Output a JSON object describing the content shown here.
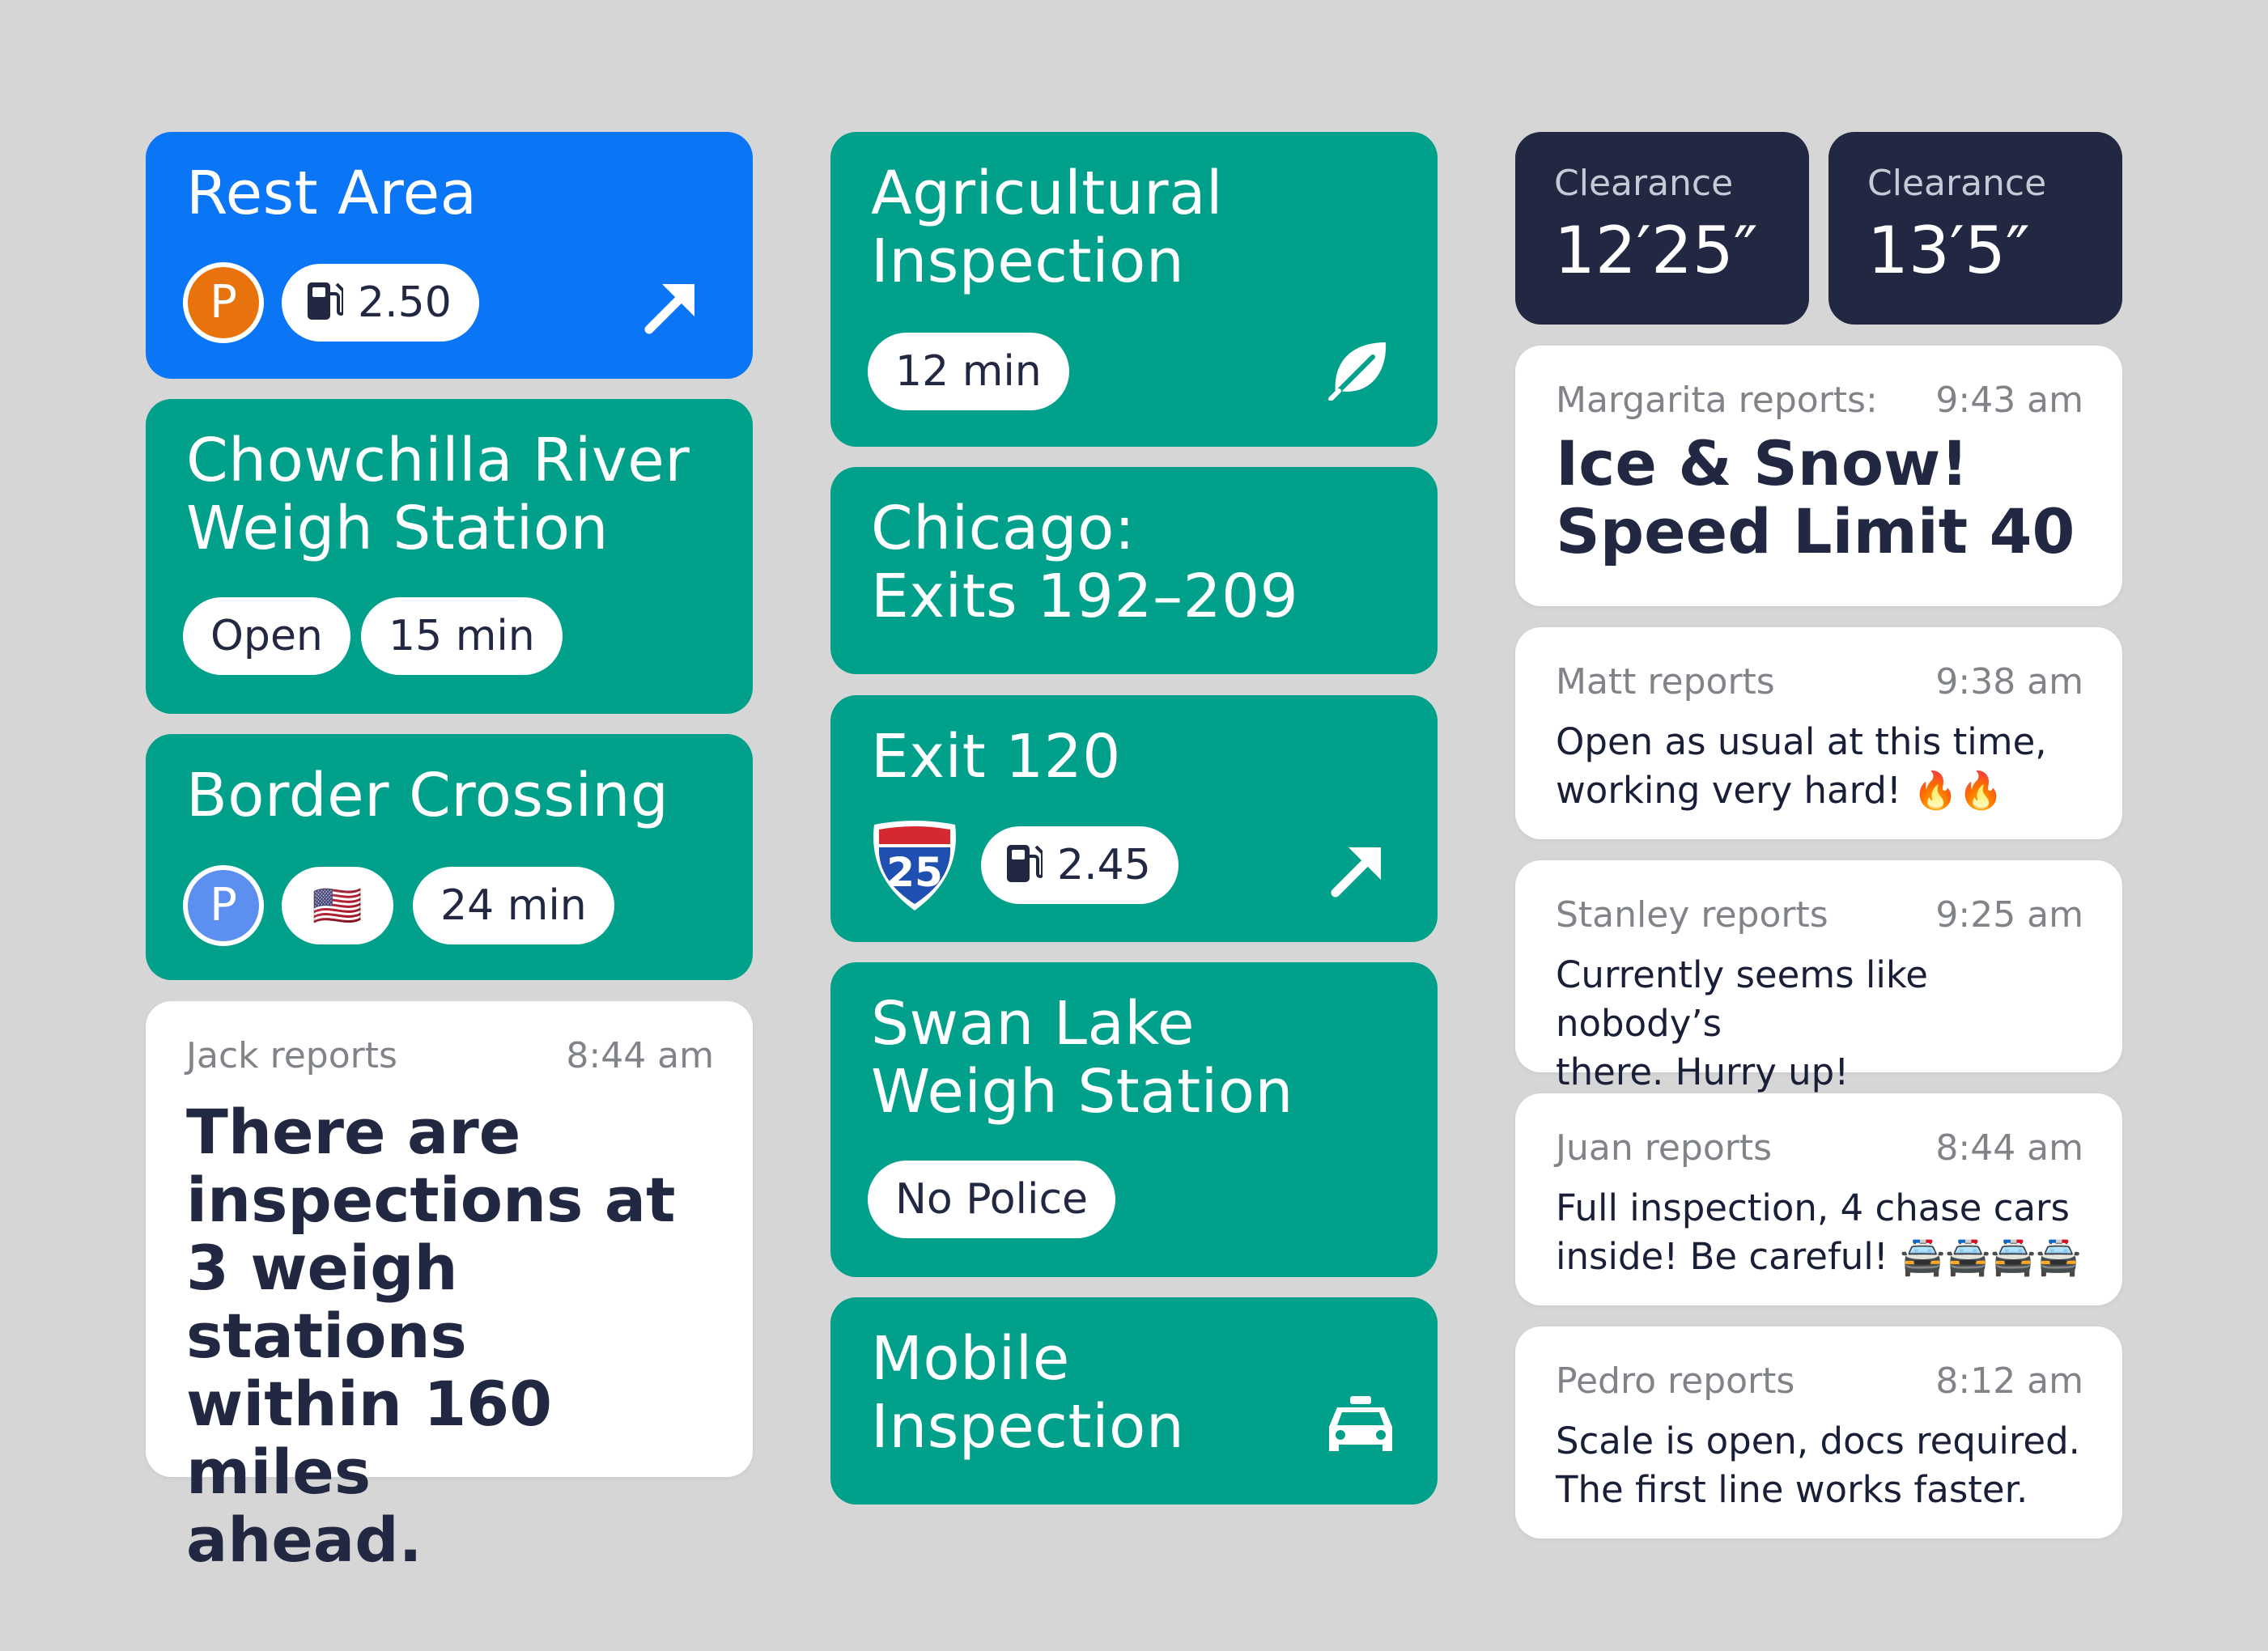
{
  "col1": {
    "rest_area": {
      "title": "Rest Area",
      "parking": "P",
      "fuel_price": "2.50"
    },
    "chowchilla": {
      "title": "Chowchilla River\nWeigh Station",
      "status": "Open",
      "time": "15 min"
    },
    "border": {
      "title": "Border Crossing",
      "parking": "P",
      "flag": "🇺🇸",
      "time": "24 min"
    },
    "jack": {
      "who": "Jack reports",
      "time": "8:44 am",
      "message": "There are\ninspections at\n3 weigh stations\nwithin 160 miles\nahead."
    }
  },
  "col2": {
    "agricultural": {
      "title": "Agricultural\nInspection",
      "time": "12 min"
    },
    "chicago": {
      "title": "Chicago:\nExits 192–209"
    },
    "exit120": {
      "title": "Exit 120",
      "shield": "25",
      "fuel_price": "2.45"
    },
    "swan_lake": {
      "title": "Swan Lake\nWeigh Station",
      "status": "No Police"
    },
    "mobile": {
      "title": "Mobile\nInspection"
    }
  },
  "col3": {
    "clearance1": {
      "label": "Clearance",
      "value": "12′25″"
    },
    "clearance2": {
      "label": "Clearance",
      "value": "13′5″"
    },
    "margarita": {
      "who": "Margarita reports:",
      "time": "9:43 am",
      "message": "Ice & Snow!\nSpeed Limit 40"
    },
    "matt": {
      "who": "Matt reports",
      "time": "9:38 am",
      "message": "Open as usual at this time,\nworking very hard! 🔥🔥"
    },
    "stanley": {
      "who": "Stanley reports",
      "time": "9:25 am",
      "message": "Currently seems like nobody’s\nthere. Hurry up!"
    },
    "juan": {
      "who": "Juan reports",
      "time": "8:44 am",
      "message": "Full inspection, 4 chase cars\ninside! Be careful!  🚔🚔🚔🚔"
    },
    "pedro": {
      "who": "Pedro reports",
      "time": "8:12 am",
      "message": "Scale is open, docs required.\nThe first line works faster."
    }
  },
  "colors": {
    "background": "#d6d6d6",
    "blue": "#0a75f5",
    "teal": "#00a08a",
    "navy": "#232842",
    "parking_orange": "#e8730c",
    "parking_blue": "#5c8ff0",
    "interstate_blue": "#1f4fb0",
    "interstate_red": "#d42a2f"
  },
  "icons": [
    "parking-icon",
    "fuel-pump-icon",
    "arrow-up-right-icon",
    "leaf-icon",
    "interstate-shield-icon",
    "us-flag-icon",
    "car-icon"
  ]
}
